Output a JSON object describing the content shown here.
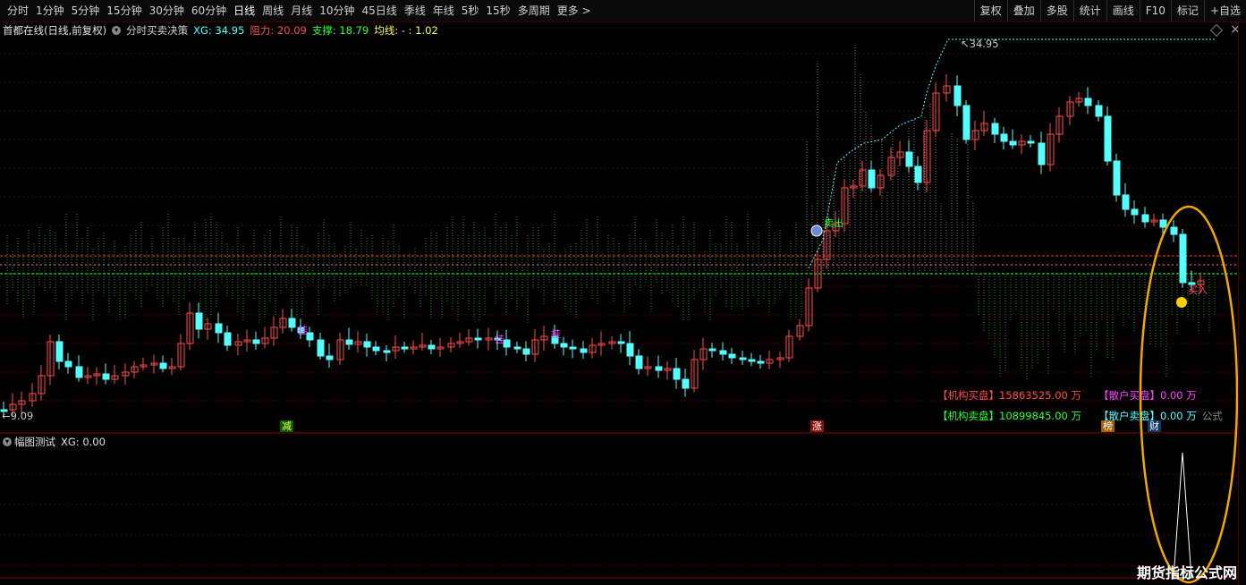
{
  "toolbar": {
    "periods": [
      "分时",
      "1分钟",
      "5分钟",
      "15分钟",
      "30分钟",
      "60分钟",
      "日线",
      "周线",
      "月线",
      "10分钟",
      "45日线",
      "季线",
      "年线",
      "5秒",
      "15秒",
      "多周期",
      "更多 >"
    ],
    "active_period": "日线",
    "right_items": [
      "复权",
      "叠加",
      "多股",
      "统计",
      "画线",
      "F10",
      "标记",
      "+自选"
    ]
  },
  "main_panel": {
    "stock_title": "首都在线(日线,前复权)",
    "indicator_name": "分时买卖决策",
    "xg_label": "XG: 34.95",
    "resist_label": "阻力: 20.09",
    "support_label": "支撑: 18.79",
    "avg_label": "均线: - : 1.02",
    "high_mark": "34.95",
    "low_mark": "9.09",
    "buy_signal": "买入",
    "stats": {
      "inst_buy_label": "【机构买盘】",
      "inst_buy_value": "15863525.00 万",
      "retail_buy_label": "【散户买盘】",
      "retail_buy_value": "0.00 万",
      "inst_sell_label": "【机构卖盘】",
      "inst_sell_value": "10899845.00 万",
      "retail_sell_label": "【散户卖盘】",
      "retail_sell_value": "0.00 万",
      "formula_text": "公式"
    },
    "tags": {
      "jian": "减",
      "zhang": "涨",
      "bang": "榜",
      "cai": "财",
      "gua": "挂",
      "mai": "卖出"
    }
  },
  "sub_panel": {
    "title": "幅图测试",
    "xg_label": "XG: 0.00"
  },
  "watermark": "期货指标公式网",
  "colors": {
    "up": "#ff4c4c",
    "down": "#54ffff",
    "grid": "#5a0000",
    "highlight_ellipse": "#f0a800",
    "resist": "#ff3030",
    "support": "#30ff30"
  }
}
